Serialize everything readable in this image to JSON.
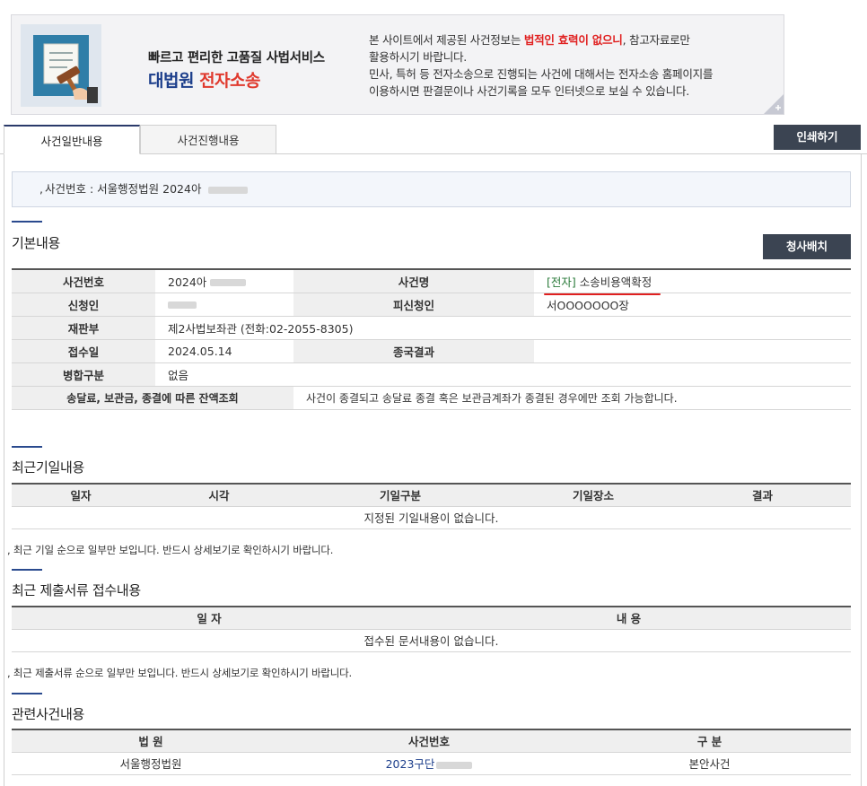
{
  "banner": {
    "tagline": "빠르고 편리한 고품질 사법서비스",
    "brand_main": "대법원",
    "brand_accent": "전자소송",
    "notice_line1_pre": "본 사이트에서 제공된 사건정보는 ",
    "notice_line1_warn": "법적인 효력이 없으니",
    "notice_line1_post": ", 참고자료로만",
    "notice_line2": "활용하시기 바랍니다.",
    "notice_line3": "민사, 특허 등 전자소송으로 진행되는 사건에 대해서는 전자소송 홈페이지를",
    "notice_line4": "이용하시면 판결문이나 사건기록을 모두 인터넷으로 보실 수 있습니다."
  },
  "tabs": [
    {
      "label": "사건일반내용"
    },
    {
      "label": "사건진행내용"
    }
  ],
  "print_button": "인쇄하기",
  "case_header": {
    "bullet": ",",
    "text": "사건번호 : 서울행정법원 2024아"
  },
  "basic": {
    "title": "기본내용",
    "button": "청사배치",
    "rows": [
      {
        "l1": "사건번호",
        "v1": "2024아",
        "l2": "사건명",
        "v2_tag": "[전자]",
        "v2": " 소송비용액확정"
      },
      {
        "l1": "신청인",
        "v1": "",
        "l2": "피신청인",
        "v2": "서OOOOOOO장"
      },
      {
        "l1": "재판부",
        "v1": "제2사법보좌관 (전화:02-2055-8305)"
      },
      {
        "l1": "접수일",
        "v1": "2024.05.14",
        "l2": "종국결과",
        "v2": ""
      },
      {
        "l1": "병합구분",
        "v1": "없음"
      },
      {
        "l1": "송달료, 보관금, 종결에 따른 잔액조회",
        "v1": "사건이 종결되고 송달료 종결 혹은 보관금계좌가 종결된 경우에만 조회 가능합니다."
      }
    ]
  },
  "hearing": {
    "title": "최근기일내용",
    "headers": [
      "일자",
      "시각",
      "기일구분",
      "기일장소",
      "결과"
    ],
    "empty": "지정된 기일내용이 없습니다.",
    "note": ", 최근 기일 순으로 일부만 보입니다. 반드시 상세보기로 확인하시기 바랍니다."
  },
  "documents": {
    "title": "최근 제출서류 접수내용",
    "headers": [
      "일 자",
      "내 용"
    ],
    "empty": "접수된 문서내용이 없습니다.",
    "note": ", 최근 제출서류 순으로 일부만 보입니다. 반드시 상세보기로 확인하시기 바랍니다."
  },
  "related": {
    "title": "관련사건내용",
    "headers": [
      "법 원",
      "사건번호",
      "구 분"
    ],
    "rows": [
      {
        "court": "서울행정법원",
        "case_no": "2023구단",
        "type": "본안사건"
      }
    ]
  },
  "colors": {
    "brand_blue": "#1c3e8b",
    "accent_red": "#e03a2e",
    "dark_button": "#3b4452"
  }
}
